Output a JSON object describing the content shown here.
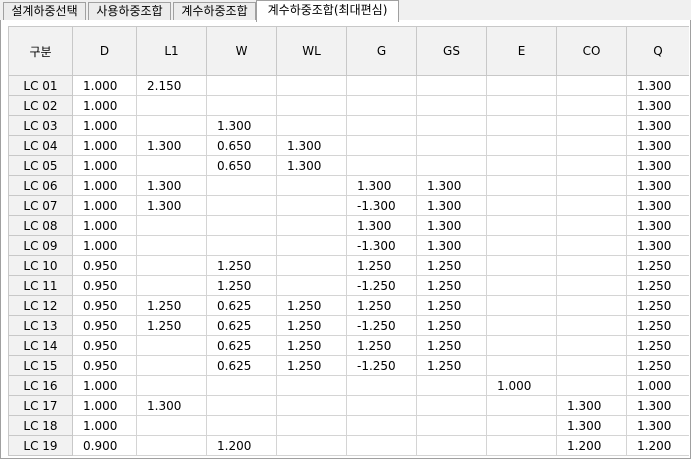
{
  "tabs": [
    {
      "label": "설계하중선택",
      "active": false
    },
    {
      "label": "사용하중조합",
      "active": false
    },
    {
      "label": "계수하중조합",
      "active": false
    },
    {
      "label": "계수하중조합(최대편심)",
      "active": true
    }
  ],
  "table": {
    "columns": [
      "구분",
      "D",
      "L1",
      "W",
      "WL",
      "G",
      "GS",
      "E",
      "CO",
      "Q"
    ],
    "rows": [
      [
        "LC 01",
        "1.000",
        "2.150",
        "",
        "",
        "",
        "",
        "",
        "",
        "1.300"
      ],
      [
        "LC 02",
        "1.000",
        "",
        "",
        "",
        "",
        "",
        "",
        "",
        "1.300"
      ],
      [
        "LC 03",
        "1.000",
        "",
        "1.300",
        "",
        "",
        "",
        "",
        "",
        "1.300"
      ],
      [
        "LC 04",
        "1.000",
        "1.300",
        "0.650",
        "1.300",
        "",
        "",
        "",
        "",
        "1.300"
      ],
      [
        "LC 05",
        "1.000",
        "",
        "0.650",
        "1.300",
        "",
        "",
        "",
        "",
        "1.300"
      ],
      [
        "LC 06",
        "1.000",
        "1.300",
        "",
        "",
        "1.300",
        "1.300",
        "",
        "",
        "1.300"
      ],
      [
        "LC 07",
        "1.000",
        "1.300",
        "",
        "",
        "-1.300",
        "1.300",
        "",
        "",
        "1.300"
      ],
      [
        "LC 08",
        "1.000",
        "",
        "",
        "",
        "1.300",
        "1.300",
        "",
        "",
        "1.300"
      ],
      [
        "LC 09",
        "1.000",
        "",
        "",
        "",
        "-1.300",
        "1.300",
        "",
        "",
        "1.300"
      ],
      [
        "LC 10",
        "0.950",
        "",
        "1.250",
        "",
        "1.250",
        "1.250",
        "",
        "",
        "1.250"
      ],
      [
        "LC 11",
        "0.950",
        "",
        "1.250",
        "",
        "-1.250",
        "1.250",
        "",
        "",
        "1.250"
      ],
      [
        "LC 12",
        "0.950",
        "1.250",
        "0.625",
        "1.250",
        "1.250",
        "1.250",
        "",
        "",
        "1.250"
      ],
      [
        "LC 13",
        "0.950",
        "1.250",
        "0.625",
        "1.250",
        "-1.250",
        "1.250",
        "",
        "",
        "1.250"
      ],
      [
        "LC 14",
        "0.950",
        "",
        "0.625",
        "1.250",
        "1.250",
        "1.250",
        "",
        "",
        "1.250"
      ],
      [
        "LC 15",
        "0.950",
        "",
        "0.625",
        "1.250",
        "-1.250",
        "1.250",
        "",
        "",
        "1.250"
      ],
      [
        "LC 16",
        "1.000",
        "",
        "",
        "",
        "",
        "",
        "1.000",
        "",
        "1.000"
      ],
      [
        "LC 17",
        "1.000",
        "1.300",
        "",
        "",
        "",
        "",
        "",
        "1.300",
        "1.300"
      ],
      [
        "LC 18",
        "1.000",
        "",
        "",
        "",
        "",
        "",
        "",
        "1.300",
        "1.300"
      ],
      [
        "LC 19",
        "0.900",
        "",
        "1.200",
        "",
        "",
        "",
        "",
        "1.200",
        "1.200"
      ]
    ]
  }
}
